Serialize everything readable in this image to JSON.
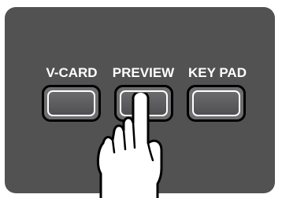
{
  "buttons": [
    {
      "label": "V-CARD"
    },
    {
      "label": "PREVIEW"
    },
    {
      "label": "KEY PAD"
    }
  ],
  "icons": {
    "pointer": "pointing-hand-icon"
  },
  "colors": {
    "panel": "#525253",
    "label": "#ffffff",
    "key_border": "#000000",
    "key_highlight": "#ffffff"
  }
}
